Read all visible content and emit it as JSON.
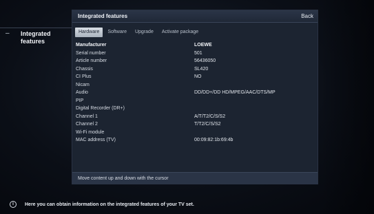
{
  "nav": {
    "dash": "–",
    "item_label": "Integrated features"
  },
  "panel": {
    "title": "Integrated features",
    "back_label": "Back",
    "tabs": [
      {
        "label": "Hardware",
        "active": true
      },
      {
        "label": "Software",
        "active": false
      },
      {
        "label": "Upgrade",
        "active": false
      },
      {
        "label": "Activate package",
        "active": false
      }
    ],
    "rows": [
      {
        "key": "Manufacturer",
        "value": "LOEWE"
      },
      {
        "key": "Serial number",
        "value": "501"
      },
      {
        "key": "Article number",
        "value": "56436050"
      },
      {
        "key": "Chassis",
        "value": "SL420"
      },
      {
        "key": "CI Plus",
        "value": "NO"
      },
      {
        "key": "Nicam",
        "value": ""
      },
      {
        "key": "Audio",
        "value": "DD/DD+/DD HD/MPEG/AAC/DTS/MP"
      },
      {
        "key": "PIP",
        "value": ""
      },
      {
        "key": "Digital Recorder (DR+)",
        "value": ""
      },
      {
        "key": "Channel 1",
        "value": "A/T/T2/C/S/S2"
      },
      {
        "key": "Channel 2",
        "value": "T/T2/C/S/S2"
      },
      {
        "key": "Wi-Fi module",
        "value": ""
      },
      {
        "key": "MAC address (TV)",
        "value": "00:09:82:1b:69:4b"
      }
    ],
    "hint": "Move content up and down with the cursor"
  },
  "footer": {
    "info_icon": "i",
    "text": "Here you can obtain information on the integrated features of your TV set."
  },
  "colors": {
    "panel_bg": "#1c2431",
    "active_tab": "#c4cad2",
    "background": "#05070c"
  }
}
